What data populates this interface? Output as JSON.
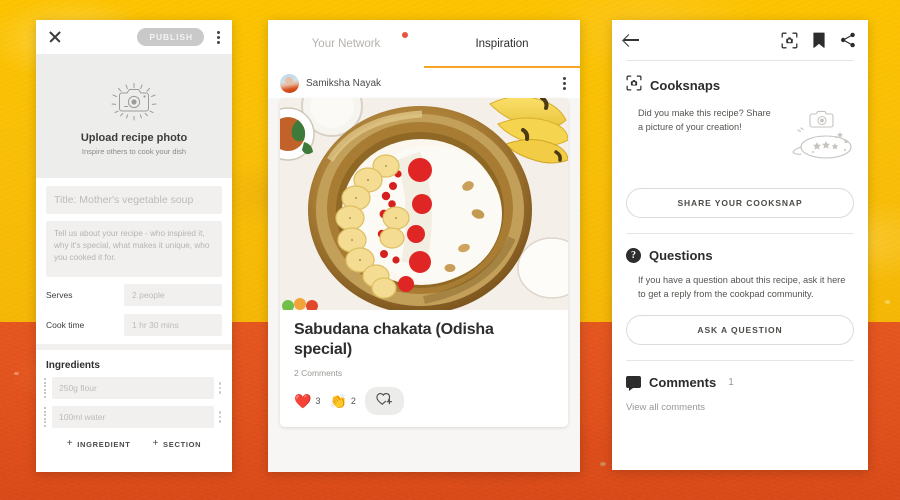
{
  "background": {
    "top_color": "#f9bf07",
    "bottom_color": "#e0511c"
  },
  "panel_create": {
    "close_icon": "close-icon",
    "publish_label": "PUBLISH",
    "menu_icon": "overflow-menu-icon",
    "photo": {
      "icon": "camera-sparkle-icon",
      "title": "Upload recipe photo",
      "subtitle": "Inspire others to cook your dish"
    },
    "title_placeholder": "Title: Mother's vegetable soup",
    "story_placeholder": "Tell us about your recipe - who inspired it, why it's special, what makes it unique, who you cooked it for.",
    "serves_label": "Serves",
    "serves_placeholder": "2 people",
    "cooktime_label": "Cook time",
    "cooktime_placeholder": "1 hr 30 mins",
    "ingredients_heading": "Ingredients",
    "ingredients": [
      {
        "placeholder": "250g flour"
      },
      {
        "placeholder": "100ml water"
      }
    ],
    "add_ingredient_label": "INGREDIENT",
    "add_section_label": "SECTION",
    "plus_glyph": "+"
  },
  "panel_feed": {
    "tabs": [
      {
        "label": "Your Network",
        "active": false,
        "has_dot": true
      },
      {
        "label": "Inspiration",
        "active": true,
        "has_dot": false
      }
    ],
    "accent_color": "#f5a623",
    "dot_color": "#e8543f",
    "post": {
      "author": "Samiksha Nayak",
      "menu_icon": "overflow-menu-icon",
      "avatar": "user-avatar",
      "photo_alt": "sabudana chakata in brass bowl with bananas",
      "title": "Sabudana chakata (Odisha special)",
      "comments_text": "2 Comments",
      "reactions": [
        {
          "emoji": "❤️",
          "name": "heart-reaction",
          "count": "3"
        },
        {
          "emoji": "👏",
          "name": "clap-reaction",
          "count": "2"
        }
      ],
      "add_reaction_icon": "add-reaction-icon"
    }
  },
  "panel_detail": {
    "back_icon": "back-arrow-icon",
    "cooksnap_icon": "cooksnap-icon",
    "bookmark_icon": "bookmark-icon",
    "share_icon": "share-icon",
    "cooksnaps": {
      "icon": "cooksnap-icon",
      "title": "Cooksnaps",
      "body": "Did you make this recipe? Share a picture of your creation!",
      "illustration": "camera-plate-illustration",
      "button_label": "SHARE YOUR COOKSNAP"
    },
    "questions": {
      "icon": "question-mark-icon",
      "title": "Questions",
      "body": "If you have a question about this recipe, ask it here to get a reply from the cookpad community.",
      "button_label": "ASK A QUESTION"
    },
    "comments": {
      "icon": "comment-bubble-icon",
      "title": "Comments",
      "count": "1",
      "view_all_label": "View all comments"
    }
  }
}
